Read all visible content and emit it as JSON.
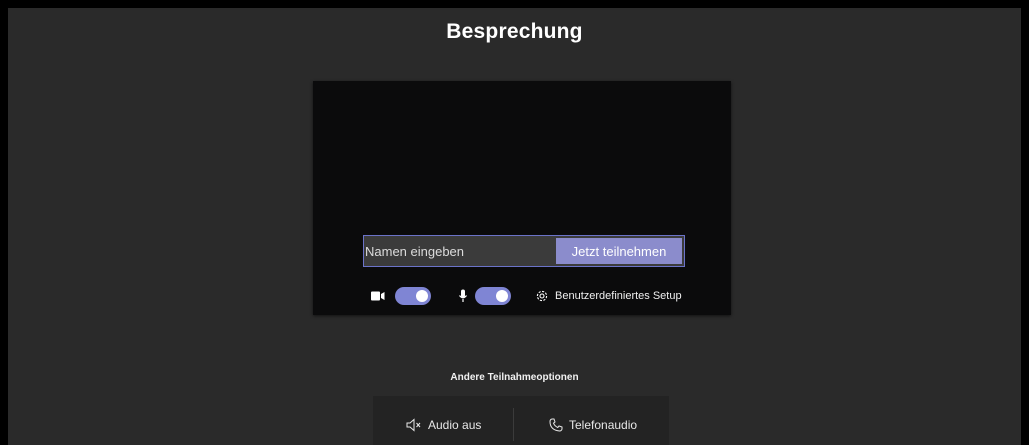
{
  "meeting": {
    "title": "Besprechung"
  },
  "join": {
    "name_placeholder": "Namen eingeben",
    "join_button_label": "Jetzt teilnehmen"
  },
  "devices": {
    "camera_on": true,
    "microphone_on": true,
    "custom_setup_label": "Benutzerdefiniertes Setup"
  },
  "other_options": {
    "title": "Andere Teilnahmeoptionen",
    "audio_off_label": "Audio aus",
    "phone_audio_label": "Telefonaudio"
  },
  "colors": {
    "accent": "#7f85d4",
    "join_button": "#8b8ccc",
    "background": "#2a2a2a"
  },
  "icons": [
    "camera-icon",
    "microphone-icon",
    "settings-gear-icon",
    "speaker-off-icon",
    "phone-icon"
  ]
}
